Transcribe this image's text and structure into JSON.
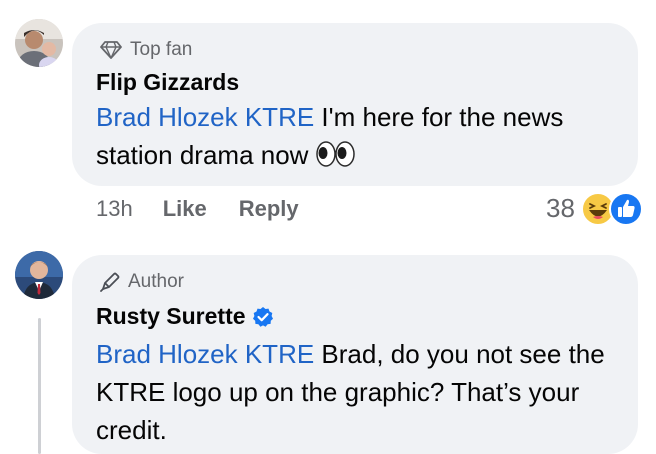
{
  "comments": [
    {
      "badge": "Top fan",
      "badge_icon": "diamond-icon",
      "author": "Flip Gizzards",
      "mention": "Brad Hlozek KTRE",
      "text": " I'm here for the news station drama now ",
      "emoji_icon": "eyes-emoji-icon",
      "time": "13h",
      "like_label": "Like",
      "reply_label": "Reply",
      "reaction_count": "38",
      "reaction_icons": [
        "haha-reaction-icon",
        "like-reaction-icon"
      ]
    },
    {
      "badge": "Author",
      "badge_icon": "pen-icon",
      "author": "Rusty Surette",
      "verified_icon": "verified-badge-icon",
      "mention": "Brad Hlozek KTRE",
      "text": " Brad, do you not see the KTRE logo up on the graphic? That’s your credit."
    }
  ],
  "colors": {
    "bubble": "#f0f2f5",
    "mention": "#2064c6",
    "secondary_text": "#65676b",
    "verified": "#1877f2",
    "like_blue": "#1877f2",
    "haha_yellow": "#f7c945"
  }
}
